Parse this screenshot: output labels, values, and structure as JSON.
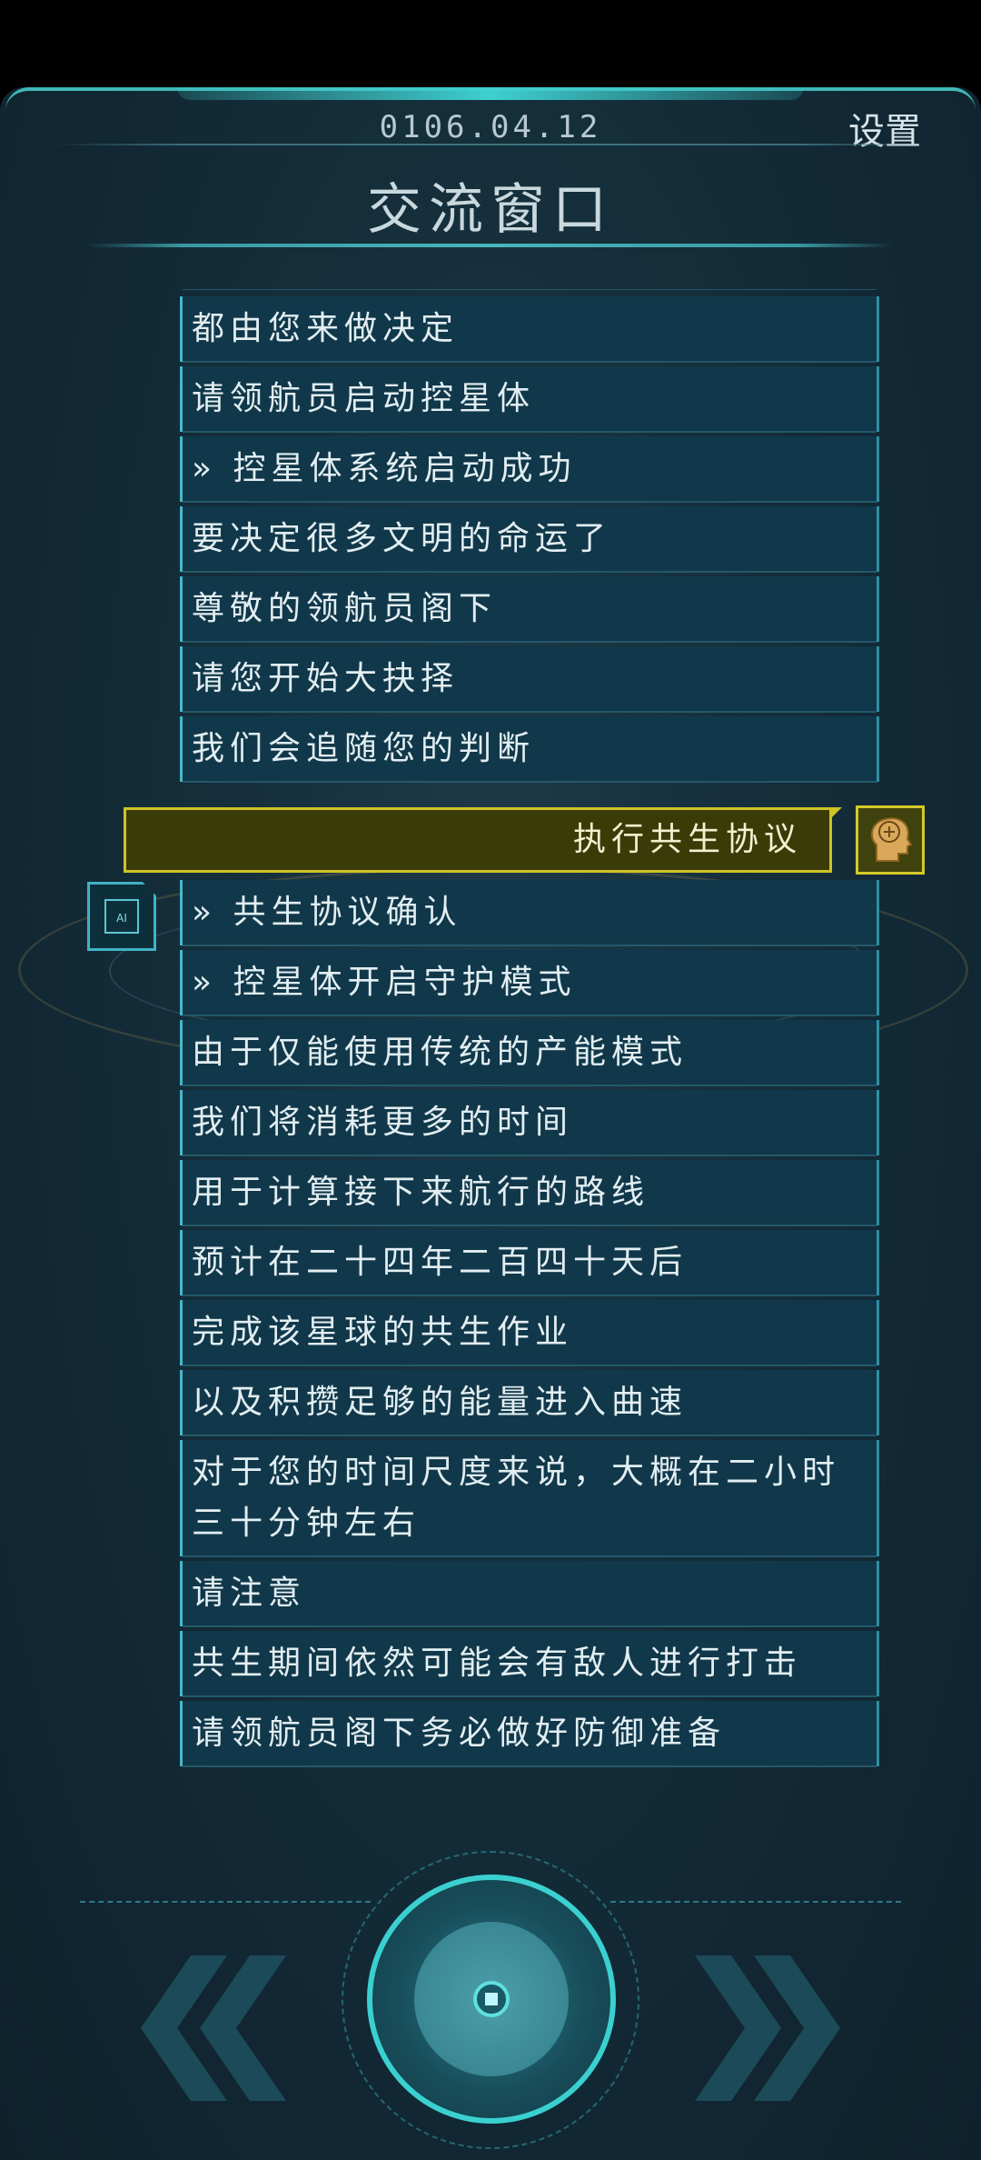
{
  "header": {
    "date": "0106.04.12",
    "settings_label": "设置",
    "title": "交流窗口"
  },
  "messages_top": [
    "都由您来做决定",
    "请领航员启动控星体",
    "» 控星体系统启动成功",
    "要决定很多文明的命运了",
    "尊敬的领航员阁下",
    "请您开始大抉择",
    "我们会追随您的判断"
  ],
  "user_message": "执行共生协议",
  "messages_bottom": [
    "» 共生协议确认",
    "» 控星体开启守护模式",
    "由于仅能使用传统的产能模式",
    "我们将消耗更多的时间",
    "用于计算接下来航行的路线",
    "预计在二十四年二百四十天后",
    "完成该星球的共生作业",
    "以及积攒足够的能量进入曲速",
    "对于您的时间尺度来说，大概在二小时三十分钟左右",
    "请注意",
    "共生期间依然可能会有敌人进行打击",
    "请领航员阁下务必做好防御准备"
  ],
  "ai_avatar_label": "AI",
  "icons": {
    "user_avatar": "brain-head-icon",
    "ai_avatar": "ai-chip-icon",
    "prev": "double-chevron-left-icon",
    "next": "double-chevron-right-icon"
  },
  "colors": {
    "accent": "#3fd0d0",
    "user_bubble_border": "#cfc326",
    "message_bg": "#11384a"
  }
}
